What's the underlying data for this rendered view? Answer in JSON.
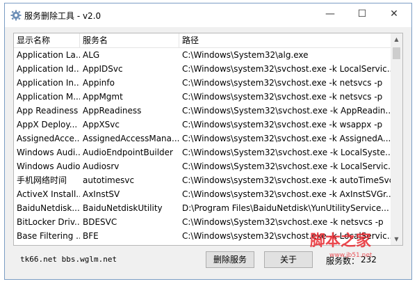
{
  "window": {
    "title": "服务删除工具 - v2.0"
  },
  "controls": {
    "minimize": "—",
    "maximize": "☐",
    "close": "✕"
  },
  "table": {
    "columns": [
      "显示名称",
      "服务名",
      "路径"
    ],
    "rows": [
      [
        "Application La...",
        "ALG",
        "C:\\Windows\\System32\\alg.exe"
      ],
      [
        "Application Id...",
        "AppIDSvc",
        "C:\\Windows\\system32\\svchost.exe -k LocalServic..."
      ],
      [
        "Application In...",
        "Appinfo",
        "C:\\Windows\\system32\\svchost.exe -k netsvcs -p"
      ],
      [
        "Application M...",
        "AppMgmt",
        "C:\\Windows\\system32\\svchost.exe -k netsvcs -p"
      ],
      [
        "App Readiness",
        "AppReadiness",
        "C:\\Windows\\System32\\svchost.exe -k AppReadin..."
      ],
      [
        "AppX Deploy...",
        "AppXSvc",
        "C:\\Windows\\system32\\svchost.exe -k wsappx -p"
      ],
      [
        "AssignedAcce...",
        "AssignedAccessMana...",
        "C:\\Windows\\system32\\svchost.exe -k AssignedA..."
      ],
      [
        "Windows Audi...",
        "AudioEndpointBuilder",
        "C:\\Windows\\System32\\svchost.exe -k LocalSyste..."
      ],
      [
        "Windows Audio",
        "Audiosrv",
        "C:\\Windows\\System32\\svchost.exe -k LocalServic..."
      ],
      [
        "手机网络时间",
        "autotimesvc",
        "C:\\Windows\\system32\\svchost.exe -k autoTimeSvc"
      ],
      [
        "ActiveX Install...",
        "AxInstSV",
        "C:\\Windows\\system32\\svchost.exe -k AxInstSVGr..."
      ],
      [
        "BaiduNetdisk...",
        "BaiduNetdiskUtility",
        "D:\\Program Files\\BaiduNetdisk\\YunUtilityService..."
      ],
      [
        "BitLocker Driv...",
        "BDESVC",
        "C:\\Windows\\System32\\svchost.exe -k netsvcs -p"
      ],
      [
        "Base Filtering ...",
        "BFE",
        "C:\\Windows\\system32\\svchost.exe -k LocalServic..."
      ]
    ]
  },
  "footer": {
    "sites": "tk66.net  bbs.wglm.net",
    "delete_button": "删除服务",
    "about_button": "关于",
    "count_label": "服务数：",
    "count_value": "232"
  },
  "watermark": {
    "text": "脚本之家",
    "url": "www.jb51.net"
  },
  "colors": {
    "accent": "#e8272e",
    "border": "#7a9cc4"
  }
}
